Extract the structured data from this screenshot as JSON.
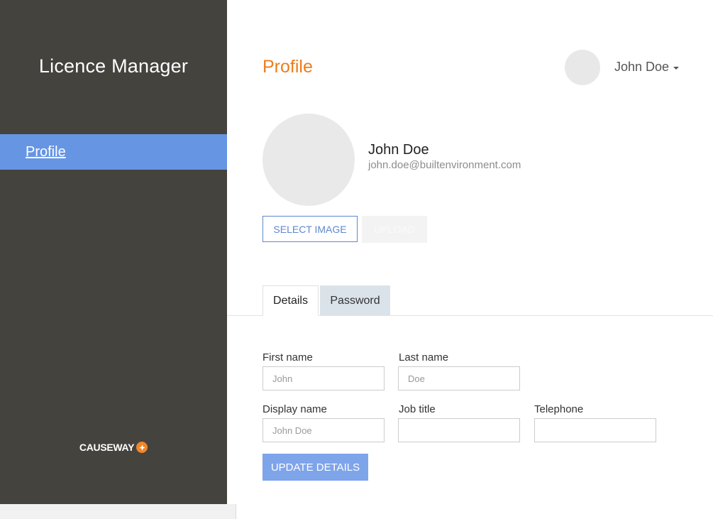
{
  "sidebar": {
    "app_title": "Licence Manager",
    "nav_items": [
      {
        "label": "Profile",
        "active": true
      }
    ],
    "brand": "CAUSEWAY"
  },
  "header": {
    "page_title": "Profile",
    "user_name": "John Doe"
  },
  "profile": {
    "name": "John Doe",
    "email": "john.doe@builtenvironment.com",
    "select_image_label": "SELECT IMAGE",
    "upload_label": "UPLOAD"
  },
  "tabs": [
    {
      "label": "Details",
      "active": true
    },
    {
      "label": "Password",
      "active": false
    }
  ],
  "form": {
    "first_name": {
      "label": "First name",
      "placeholder": "John",
      "value": ""
    },
    "last_name": {
      "label": "Last name",
      "placeholder": "Doe",
      "value": ""
    },
    "display_name": {
      "label": "Display name",
      "placeholder": "John Doe",
      "value": ""
    },
    "job_title": {
      "label": "Job title",
      "placeholder": "",
      "value": ""
    },
    "telephone": {
      "label": "Telephone",
      "placeholder": "",
      "value": ""
    },
    "submit_label": "UPDATE DETAILS"
  },
  "colors": {
    "sidebar_bg": "#45433e",
    "nav_active": "#6695e3",
    "accent_orange": "#ee7d1c",
    "primary_button": "#7ea4ea",
    "outline_blue": "#5f87cf"
  }
}
